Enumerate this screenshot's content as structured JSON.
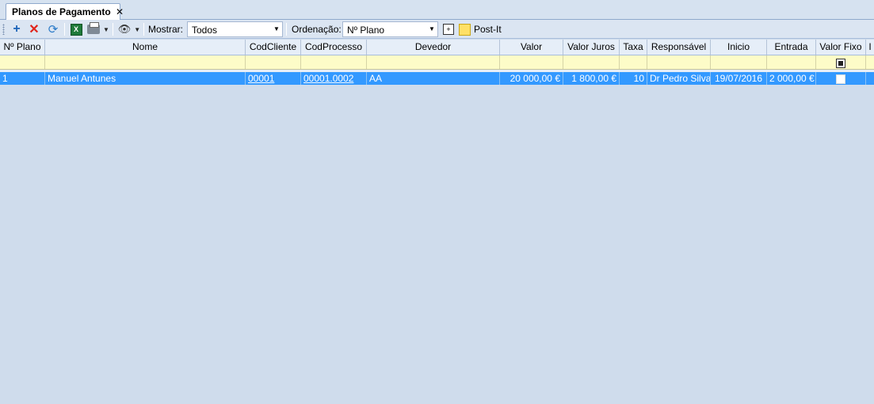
{
  "tab": {
    "title": "Planos de Pagamento",
    "close": "✕"
  },
  "toolbar": {
    "mostrar_label": "Mostrar:",
    "mostrar_value": "Todos",
    "ordenacao_label": "Ordenação:",
    "ordenacao_value": "Nº Plano",
    "postit_label": "Post-It",
    "excel_glyph": "X"
  },
  "columns": {
    "num_plano": "Nº Plano",
    "nome": "Nome",
    "cod_cliente": "CodCliente",
    "cod_processo": "CodProcesso",
    "devedor": "Devedor",
    "valor": "Valor",
    "valor_juros": "Valor Juros",
    "taxa": "Taxa",
    "responsavel": "Responsável",
    "inicio": "Inicio",
    "entrada": "Entrada",
    "valor_fixo": "Valor Fixo",
    "next": "I"
  },
  "rows": [
    {
      "num_plano": "1",
      "nome": "Manuel Antunes",
      "cod_cliente": "00001",
      "cod_processo": "00001.0002",
      "devedor": "AA",
      "valor": "20 000,00 €",
      "valor_juros": "1 800,00 €",
      "taxa": "10",
      "responsavel": "Dr Pedro Silva",
      "inicio": "19/07/2016",
      "entrada": "2 000,00 €",
      "valor_fixo": false
    }
  ],
  "colors": {
    "selection": "#3399ff",
    "filter_row": "#fdfcc8",
    "background": "#cfdcec"
  }
}
